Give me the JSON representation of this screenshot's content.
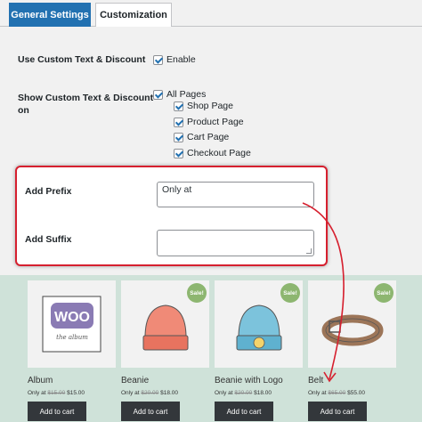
{
  "tabs": [
    {
      "label": "General Settings",
      "active": true
    },
    {
      "label": "Customization",
      "active": false
    }
  ],
  "settings": {
    "use_custom": {
      "label": "Use Custom Text & Discount",
      "option": "Enable"
    },
    "show_custom": {
      "label_line1": "Show Custom Text & Discount",
      "label_line2": "on",
      "all_pages": "All Pages",
      "pages": [
        "Shop Page",
        "Product Page",
        "Cart Page",
        "Checkout Page"
      ]
    },
    "prefix": {
      "label": "Add Prefix",
      "value": "Only at"
    },
    "suffix": {
      "label": "Add Suffix",
      "value": ""
    }
  },
  "products": [
    {
      "name": "Album",
      "prefix": "Only at",
      "old_price": "$15.00",
      "new_price": "$15.00",
      "sale": false,
      "button": "Add to cart"
    },
    {
      "name": "Beanie",
      "prefix": "Only at",
      "old_price": "$20.00",
      "new_price": "$18.00",
      "sale": true,
      "button": "Add to cart"
    },
    {
      "name": "Beanie with Logo",
      "prefix": "Only at",
      "old_price": "$20.00",
      "new_price": "$18.00",
      "sale": true,
      "button": "Add to cart"
    },
    {
      "name": "Belt",
      "prefix": "Only at",
      "old_price": "$65.00",
      "new_price": "$55.00",
      "sale": true,
      "button": "Add to cart"
    }
  ],
  "sale_badge": "Sale!",
  "album_logo": "WOO",
  "album_caption": "the album",
  "colors": {
    "accent": "#2271b1",
    "highlight": "#d6202f",
    "shop_bg": "#cfe2d9",
    "sale": "#8db670"
  }
}
